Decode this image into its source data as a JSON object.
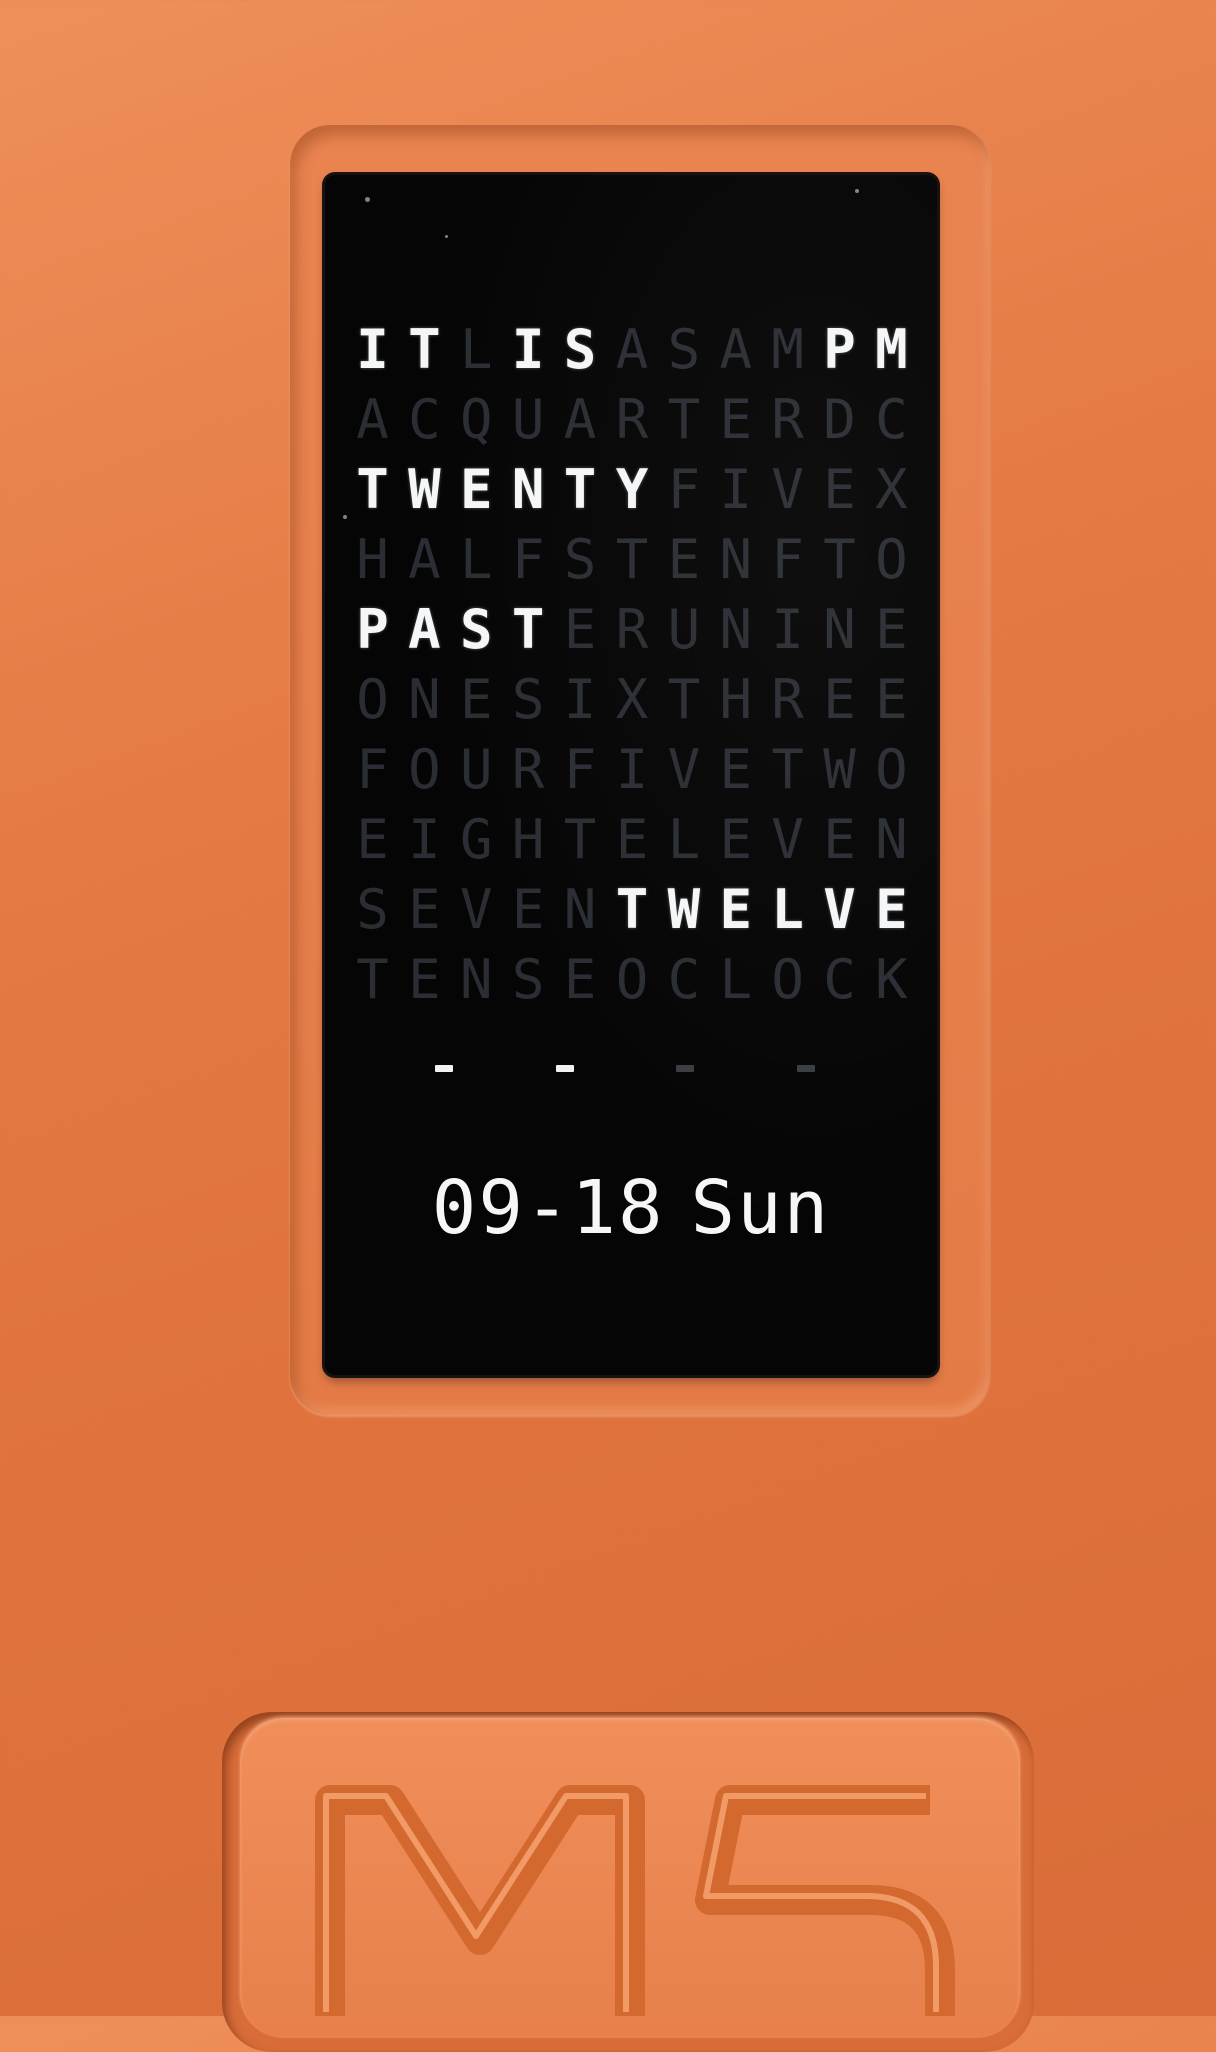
{
  "device": {
    "logo_text": "M5",
    "body_color": "#e57a44",
    "screen_color": "#050505",
    "lit_color": "#f4f6f8",
    "unlit_color": "#2a2e34"
  },
  "word_clock": {
    "rows": [
      {
        "letters": [
          "I",
          "T",
          "L",
          "I",
          "S",
          "A",
          "S",
          "A",
          "M",
          "P",
          "M"
        ],
        "lit": [
          1,
          1,
          0,
          1,
          1,
          0,
          0,
          0,
          0,
          1,
          1
        ]
      },
      {
        "letters": [
          "A",
          "C",
          "Q",
          "U",
          "A",
          "R",
          "T",
          "E",
          "R",
          "D",
          "C"
        ],
        "lit": [
          0,
          0,
          0,
          0,
          0,
          0,
          0,
          0,
          0,
          0,
          0
        ]
      },
      {
        "letters": [
          "T",
          "W",
          "E",
          "N",
          "T",
          "Y",
          "F",
          "I",
          "V",
          "E",
          "X"
        ],
        "lit": [
          1,
          1,
          1,
          1,
          1,
          1,
          0,
          0,
          0,
          0,
          0
        ]
      },
      {
        "letters": [
          "H",
          "A",
          "L",
          "F",
          "S",
          "T",
          "E",
          "N",
          "F",
          "T",
          "O"
        ],
        "lit": [
          0,
          0,
          0,
          0,
          0,
          0,
          0,
          0,
          0,
          0,
          0
        ]
      },
      {
        "letters": [
          "P",
          "A",
          "S",
          "T",
          "E",
          "R",
          "U",
          "N",
          "I",
          "N",
          "E"
        ],
        "lit": [
          1,
          1,
          1,
          1,
          0,
          0,
          0,
          0,
          0,
          0,
          0
        ]
      },
      {
        "letters": [
          "O",
          "N",
          "E",
          "S",
          "I",
          "X",
          "T",
          "H",
          "R",
          "E",
          "E"
        ],
        "lit": [
          0,
          0,
          0,
          0,
          0,
          0,
          0,
          0,
          0,
          0,
          0
        ]
      },
      {
        "letters": [
          "F",
          "O",
          "U",
          "R",
          "F",
          "I",
          "V",
          "E",
          "T",
          "W",
          "O"
        ],
        "lit": [
          0,
          0,
          0,
          0,
          0,
          0,
          0,
          0,
          0,
          0,
          0
        ]
      },
      {
        "letters": [
          "E",
          "I",
          "G",
          "H",
          "T",
          "E",
          "L",
          "E",
          "V",
          "E",
          "N"
        ],
        "lit": [
          0,
          0,
          0,
          0,
          0,
          0,
          0,
          0,
          0,
          0,
          0
        ]
      },
      {
        "letters": [
          "S",
          "E",
          "V",
          "E",
          "N",
          "T",
          "W",
          "E",
          "L",
          "V",
          "E"
        ],
        "lit": [
          0,
          0,
          0,
          0,
          0,
          1,
          1,
          1,
          1,
          1,
          1
        ]
      },
      {
        "letters": [
          "T",
          "E",
          "N",
          "S",
          "E",
          "O",
          "C",
          "L",
          "O",
          "C",
          "K"
        ],
        "lit": [
          0,
          0,
          0,
          0,
          0,
          0,
          0,
          0,
          0,
          0,
          0
        ]
      }
    ],
    "displayed_phrase": "IT IS PM TWENTY PAST TWELVE"
  },
  "seconds_dashes": [
    {
      "symbol": "-",
      "lit": true
    },
    {
      "symbol": "-",
      "lit": true
    },
    {
      "symbol": "-",
      "lit": false
    },
    {
      "symbol": "-",
      "lit": false
    }
  ],
  "date": {
    "month_day": "09-18",
    "weekday": "Sun"
  }
}
